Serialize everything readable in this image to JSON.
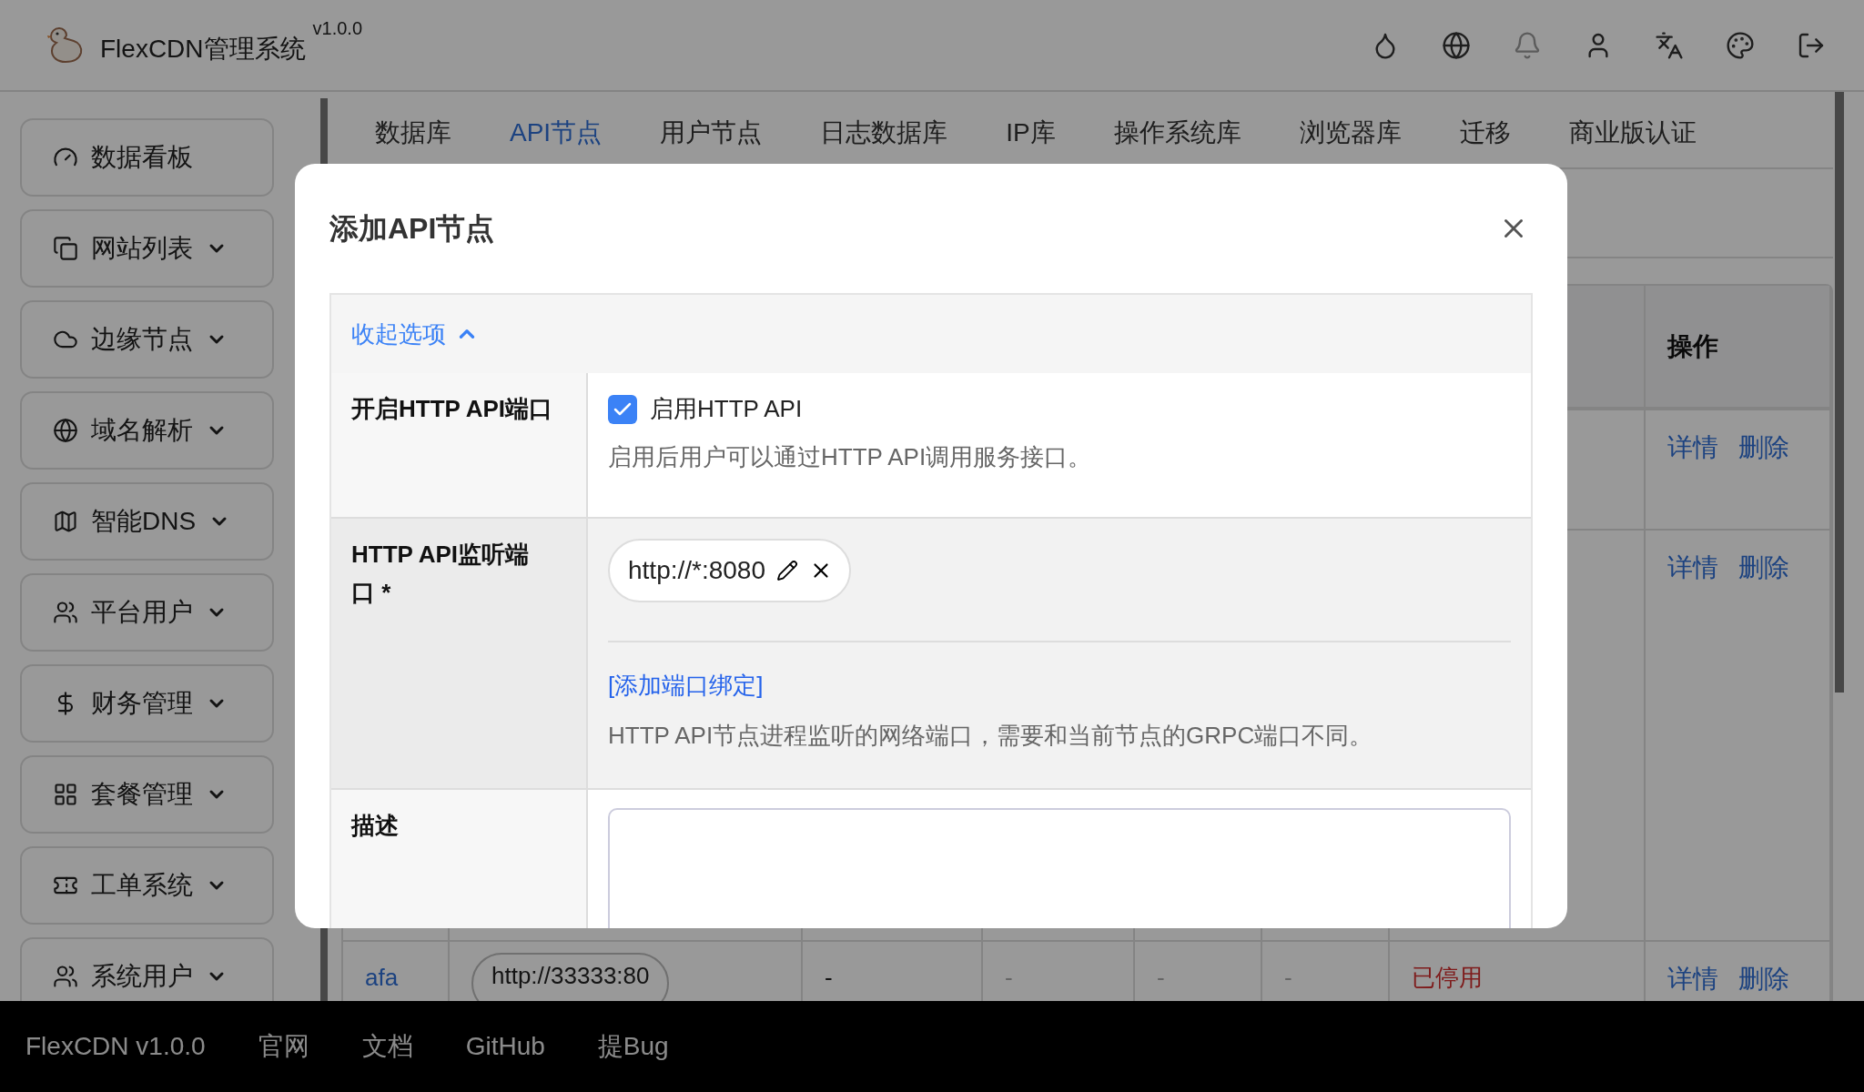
{
  "header": {
    "title": "FlexCDN管理系统",
    "version": "v1.0.0"
  },
  "sidebar": {
    "items": [
      {
        "label": "数据看板",
        "expandable": false
      },
      {
        "label": "网站列表",
        "expandable": true
      },
      {
        "label": "边缘节点",
        "expandable": true
      },
      {
        "label": "域名解析",
        "expandable": true
      },
      {
        "label": "智能DNS",
        "expandable": true
      },
      {
        "label": "平台用户",
        "expandable": true
      },
      {
        "label": "财务管理",
        "expandable": true
      },
      {
        "label": "套餐管理",
        "expandable": true
      },
      {
        "label": "工单系统",
        "expandable": true
      },
      {
        "label": "系统用户",
        "expandable": true
      }
    ]
  },
  "tabs": [
    {
      "label": "数据库",
      "selected": false
    },
    {
      "label": "API节点",
      "selected": true
    },
    {
      "label": "用户节点",
      "selected": false
    },
    {
      "label": "日志数据库",
      "selected": false
    },
    {
      "label": "IP库",
      "selected": false
    },
    {
      "label": "操作系统库",
      "selected": false
    },
    {
      "label": "浏览器库",
      "selected": false
    },
    {
      "label": "迁移",
      "selected": false
    },
    {
      "label": "商业版认证",
      "selected": false
    }
  ],
  "table": {
    "action_header": "操作",
    "rows": [
      {
        "cells": [],
        "actions": [
          "详情",
          "删除"
        ]
      },
      {
        "cells": [],
        "actions": [
          "详情",
          "删除"
        ]
      },
      {
        "cells": [
          {
            "kind": "link",
            "text": "afa"
          },
          {
            "kind": "pill",
            "text": "http://33333:80"
          },
          {
            "kind": "text",
            "text": "-"
          },
          {
            "kind": "muted",
            "text": "-"
          },
          {
            "kind": "muted",
            "text": "-"
          },
          {
            "kind": "muted",
            "text": "-"
          },
          {
            "kind": "status",
            "text": "已停用"
          }
        ],
        "actions": [
          "详情",
          "删除"
        ]
      }
    ]
  },
  "dialog": {
    "title": "添加API节点",
    "collapse_link": "收起选项",
    "enable_row": {
      "label": "开启HTTP API端口",
      "checkbox_label": "启用HTTP API",
      "checked": true,
      "help": "启用后用户可以通过HTTP API调用服务接口。"
    },
    "port_row": {
      "label": "HTTP API监听端口 *",
      "ports": [
        "http://*:8080"
      ],
      "add_link": "[添加端口绑定]",
      "help": "HTTP API节点进程监听的网络端口，需要和当前节点的GRPC端口不同。"
    },
    "description_row": {
      "label": "描述"
    }
  },
  "footer": {
    "items": [
      "FlexCDN v1.0.0",
      "官网",
      "文档",
      "GitHub",
      "提Bug"
    ]
  }
}
